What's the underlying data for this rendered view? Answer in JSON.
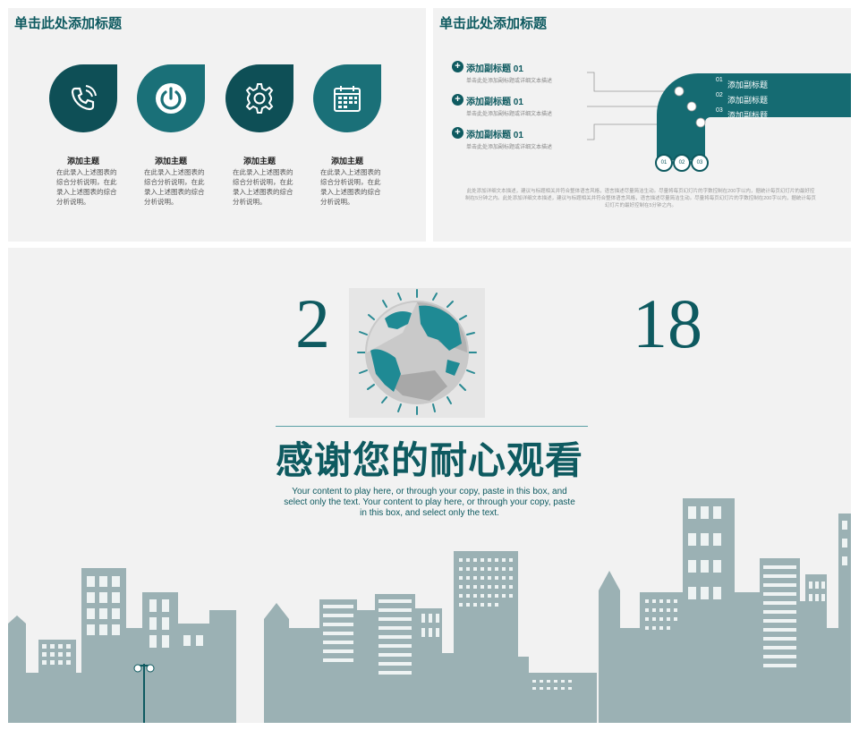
{
  "slide1": {
    "title": "单击此处添加标题",
    "features": [
      {
        "icon": "phone-icon",
        "title": "添加主题",
        "desc": "在此录入上述图表的综合分析说明，在此录入上述图表的综合分析说明。",
        "color": "#0e4f56"
      },
      {
        "icon": "power-icon",
        "title": "添加主题",
        "desc": "在此录入上述图表的综合分析说明，在此录入上述图表的综合分析说明。",
        "color": "#1a7078"
      },
      {
        "icon": "gear-icon",
        "title": "添加主题",
        "desc": "在此录入上述图表的综合分析说明，在此录入上述图表的综合分析说明。",
        "color": "#0e4f56"
      },
      {
        "icon": "calendar-icon",
        "title": "添加主题",
        "desc": "在此录入上述图表的综合分析说明，在此录入上述图表的综合分析说明。",
        "color": "#1a7078"
      }
    ]
  },
  "slide2": {
    "title": "单击此处添加标题",
    "subtitles": [
      {
        "title": "添加副标题 01",
        "desc": "单击此处添加副标题或详细文本描述"
      },
      {
        "title": "添加副标题 01",
        "desc": "单击此处添加副标题或详细文本描述"
      },
      {
        "title": "添加副标题 01",
        "desc": "单击此处添加副标题或详细文本描述"
      }
    ],
    "band": [
      {
        "num": "01",
        "label": "添加副标题"
      },
      {
        "num": "02",
        "label": "添加副标题"
      },
      {
        "num": "03",
        "label": "添加副标题"
      }
    ],
    "circles": [
      "01",
      "02",
      "03"
    ],
    "footer": "此处添加详细文本描述，建议与标题相关并符合整体语言风格，语言描述尽量简洁生动。尽量将每页幻灯片的字数控制在200字以内，据统计每页幻灯片的最好控制在5分钟之内。此处添加详细文本描述，建议与标题相关并符合整体语言风格，语言描述尽量简洁生动。尽量将每页幻灯片的字数控制在200字以内，据统计每页幻灯片的最好控制在5分钟之内。"
  },
  "slide3": {
    "year_left": "2",
    "year_right": "18",
    "thanks": "感谢您的耐心观看",
    "english": "Your content to play here, or through your copy, paste in this box, and select only the text. Your content to play here, or through your copy, paste in this box, and select only the text."
  },
  "colors": {
    "accent": "#0e5a60",
    "city": "#9bb1b4",
    "slide_bg": "#f2f2f2"
  }
}
